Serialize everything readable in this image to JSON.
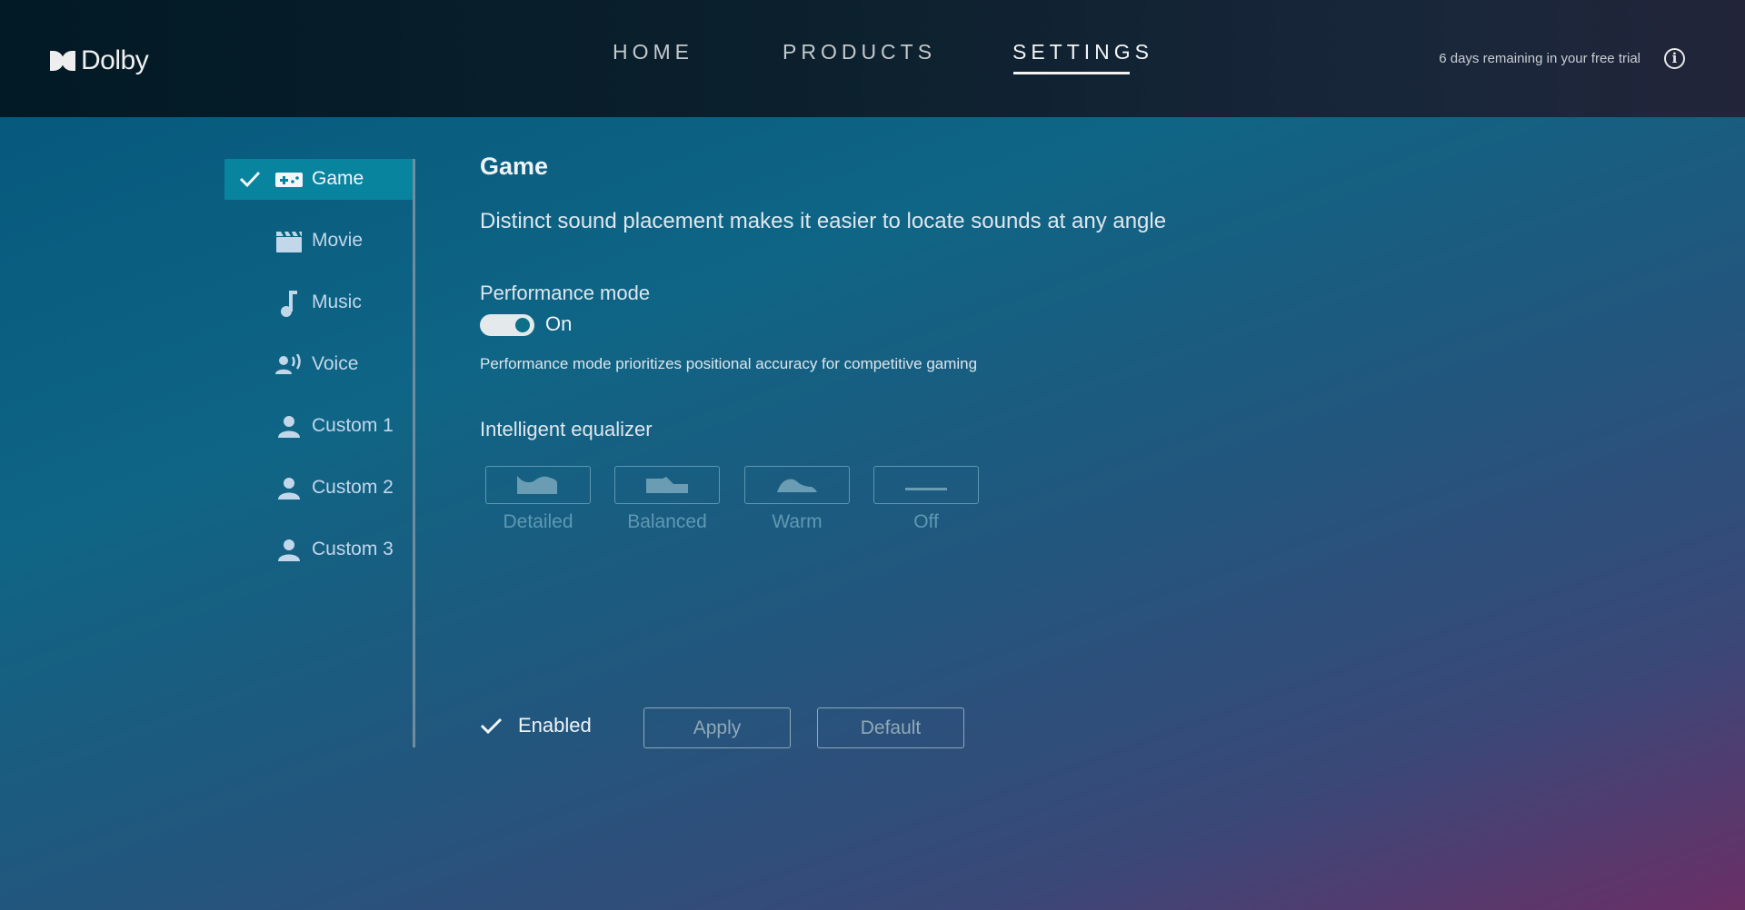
{
  "header": {
    "logo_text": "Dolby",
    "nav": [
      {
        "label": "HOME",
        "active": false
      },
      {
        "label": "PRODUCTS",
        "active": false
      },
      {
        "label": "SETTINGS",
        "active": true
      }
    ],
    "trial_text": "6 days remaining in your free trial",
    "info_icon": "info-icon"
  },
  "sidebar": {
    "items": [
      {
        "label": "Game",
        "icon": "gamepad-icon",
        "active": true
      },
      {
        "label": "Movie",
        "icon": "clapperboard-icon",
        "active": false
      },
      {
        "label": "Music",
        "icon": "music-note-icon",
        "active": false
      },
      {
        "label": "Voice",
        "icon": "voice-icon",
        "active": false
      },
      {
        "label": "Custom 1",
        "icon": "person-icon",
        "active": false
      },
      {
        "label": "Custom 2",
        "icon": "person-icon",
        "active": false
      },
      {
        "label": "Custom 3",
        "icon": "person-icon",
        "active": false
      }
    ]
  },
  "main": {
    "title": "Game",
    "description": "Distinct sound placement makes it easier to locate sounds at any angle",
    "performance": {
      "label": "Performance mode",
      "state": "On",
      "enabled": true,
      "note": "Performance mode prioritizes positional accuracy for competitive gaming"
    },
    "equalizer": {
      "label": "Intelligent equalizer",
      "options": [
        {
          "label": "Detailed",
          "icon": "eq-detailed-icon"
        },
        {
          "label": "Balanced",
          "icon": "eq-balanced-icon"
        },
        {
          "label": "Warm",
          "icon": "eq-warm-icon"
        },
        {
          "label": "Off",
          "icon": "eq-off-icon"
        }
      ]
    },
    "footer": {
      "enabled_label": "Enabled",
      "enabled_checked": true,
      "apply_label": "Apply",
      "default_label": "Default"
    }
  },
  "colors": {
    "accent_selected": "#08849e",
    "toggle_knob": "#0c7088",
    "icon_tint": "#c2d7ea"
  }
}
